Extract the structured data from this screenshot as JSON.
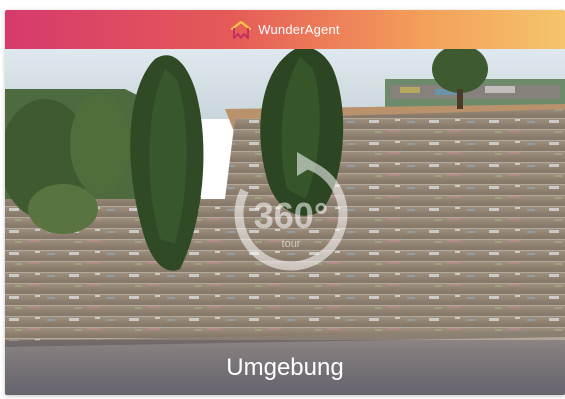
{
  "header": {
    "brand_name": "WunderAgent",
    "logo_icon": "house-logo-icon"
  },
  "viewer": {
    "badge_icon": "360-tour-icon",
    "badge_text": "360°",
    "badge_subtext": "tour"
  },
  "caption": {
    "label": "Umgebung"
  },
  "colors": {
    "header_gradient_start": "#d63a6d",
    "header_gradient_end": "#f5c46b",
    "caption_overlay": "#505064"
  }
}
